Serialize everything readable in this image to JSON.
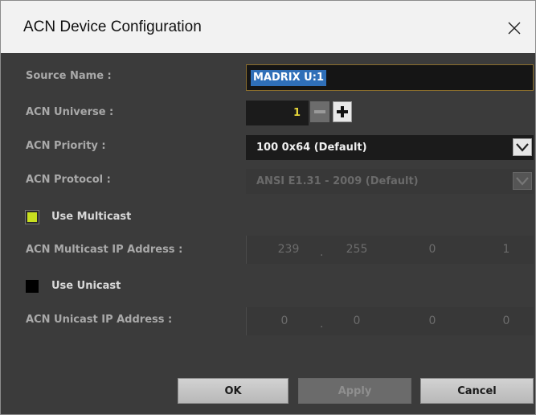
{
  "window": {
    "title": "ACN Device Configuration",
    "close_icon": "close-icon"
  },
  "form": {
    "source_name_label": "Source Name :",
    "source_name_value": "MADRIX U:1",
    "universe_label": "ACN Universe :",
    "universe_value": "1",
    "priority_label": "ACN Priority :",
    "priority_value": "100 0x64 (Default)",
    "protocol_label": "ACN Protocol :",
    "protocol_value": "ANSI E1.31 - 2009 (Default)",
    "use_multicast_label": "Use Multicast",
    "use_multicast_checked": true,
    "multicast_ip_label": "ACN Multicast IP Address :",
    "multicast_ip": [
      "239",
      "255",
      "0",
      "1"
    ],
    "use_unicast_label": "Use Unicast",
    "use_unicast_checked": false,
    "unicast_ip_label": "ACN Unicast IP Address :",
    "unicast_ip": [
      "0",
      "0",
      "0",
      "0"
    ]
  },
  "buttons": {
    "ok": "OK",
    "apply": "Apply",
    "cancel": "Cancel"
  },
  "colors": {
    "background": "#3b3b3b",
    "checkbox_on": "#c8e020",
    "selection": "#2f6fb8",
    "universe_text": "#e6d63a"
  }
}
